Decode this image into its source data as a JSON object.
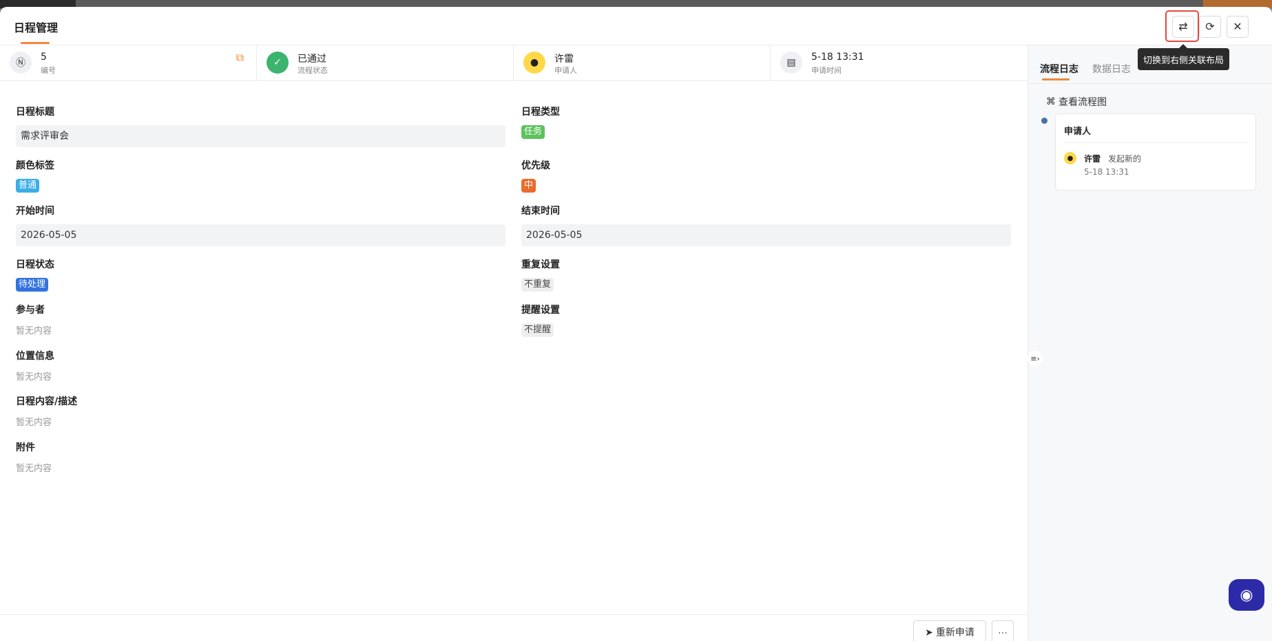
{
  "header": {
    "title": "日程管理",
    "tooltip": "切换到右侧关联布局"
  },
  "infobar": {
    "number": {
      "value": "5",
      "label": "编号"
    },
    "status": {
      "value": "已通过",
      "label": "流程状态"
    },
    "applicant": {
      "value": "许雷",
      "label": "申请人"
    },
    "time": {
      "value": "5-18 13:31",
      "label": "申请时间"
    }
  },
  "form": {
    "title": {
      "label": "日程标题",
      "value": "需求评审会"
    },
    "type": {
      "label": "日程类型",
      "value": "任务"
    },
    "color": {
      "label": "颜色标签",
      "value": "普通"
    },
    "priority": {
      "label": "优先级",
      "value": "中"
    },
    "start": {
      "label": "开始时间",
      "value": "2026-05-05"
    },
    "end": {
      "label": "结束时间",
      "value": "2026-05-05"
    },
    "status": {
      "label": "日程状态",
      "value": "待处理"
    },
    "repeat": {
      "label": "重复设置",
      "value": "不重复"
    },
    "participants": {
      "label": "参与者",
      "value": "暂无内容"
    },
    "reminder": {
      "label": "提醒设置",
      "value": "不提醒"
    },
    "location": {
      "label": "位置信息",
      "value": "暂无内容"
    },
    "description": {
      "label": "日程内容/描述",
      "value": "暂无内容"
    },
    "attachments": {
      "label": "附件",
      "value": "暂无内容"
    }
  },
  "footer": {
    "resubmit_label": "重新申请",
    "more_label": "···"
  },
  "rpanel": {
    "tabs": [
      {
        "label": "流程日志"
      },
      {
        "label": "数据日志"
      }
    ],
    "view_flow_label": "查看流程图",
    "log": {
      "node_title": "申请人",
      "user": "许雷",
      "action": "发起新的",
      "time": "5-18 13:31"
    }
  },
  "colors": {
    "accent": "#f0883a",
    "green_status": "#3bb46e",
    "tag_task": "#5ec25e",
    "tag_normal": "#3aaee6",
    "tag_priority": "#ea6c2c",
    "tag_pending": "#3273e0",
    "highlight": "#e2483d"
  }
}
